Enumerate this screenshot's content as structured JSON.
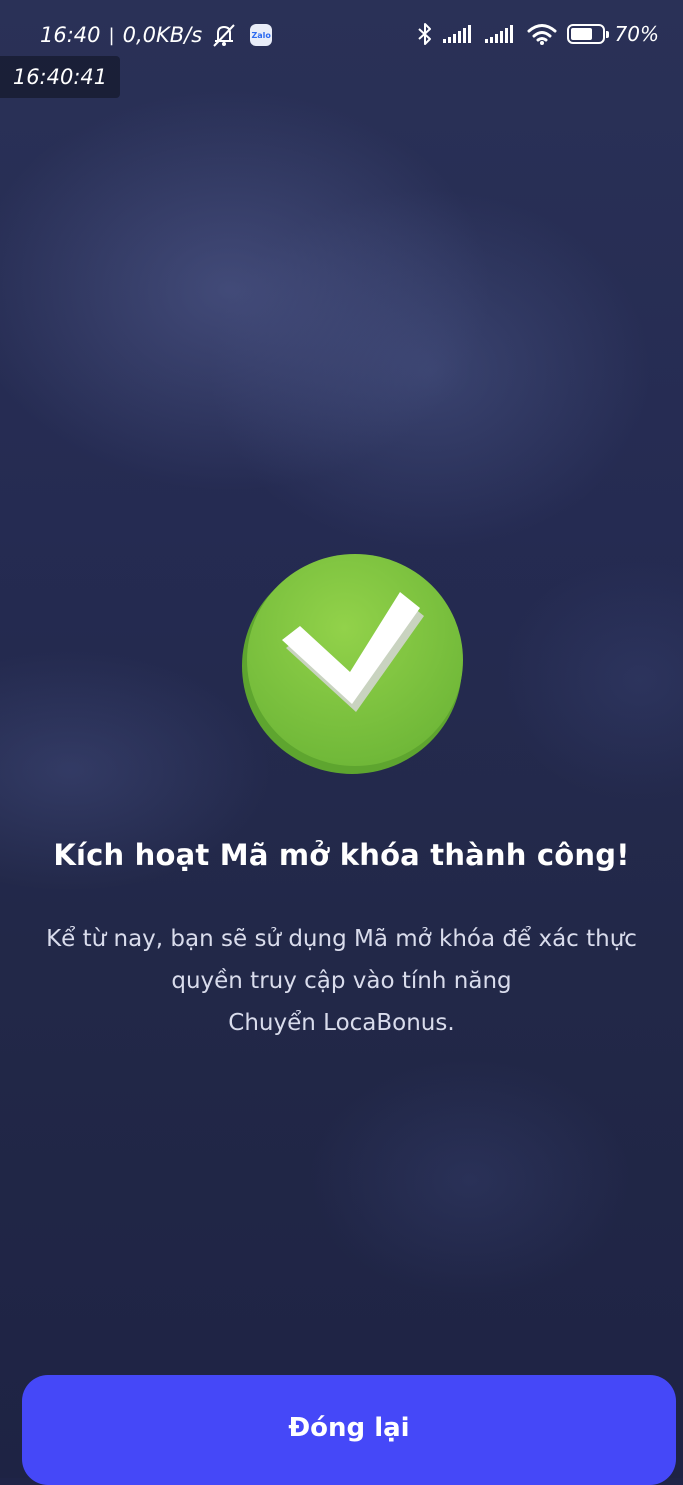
{
  "status_bar": {
    "time": "16:40",
    "separator": "|",
    "network_speed": "0,0KB/s",
    "notification_icon": "bell-off-icon",
    "app_icon_label": "Zalo",
    "battery": "70%",
    "battery_level": 0.7,
    "icons": [
      "bluetooth-icon",
      "signal-icon",
      "signal-icon",
      "wifi-icon",
      "battery-icon"
    ]
  },
  "clock_overlay": "16:40:41",
  "success": {
    "icon": "check-circle-icon",
    "title": "Kích hoạt Mã mở khóa thành công!",
    "description_lines": [
      "Kể từ nay, bạn sẽ sử dụng Mã mở khóa để xác thực",
      "quyền truy cập vào tính năng",
      "Chuyển LocaBonus."
    ]
  },
  "actions": {
    "close_label": "Đóng lại"
  },
  "colors": {
    "button": "#4548f8",
    "success_green": "#7dc242",
    "background": "#222848"
  }
}
